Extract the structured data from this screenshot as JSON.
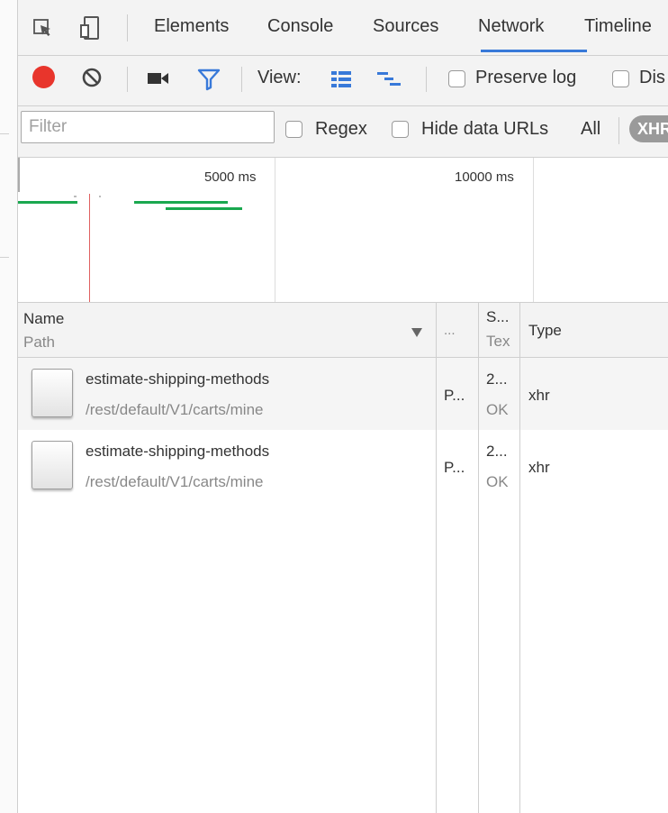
{
  "tabs": {
    "items": [
      {
        "label": "Elements"
      },
      {
        "label": "Console"
      },
      {
        "label": "Sources"
      },
      {
        "label": "Network"
      },
      {
        "label": "Timeline"
      }
    ],
    "active": "Network"
  },
  "toolbar": {
    "view_label": "View:",
    "preserve_log_label": "Preserve log",
    "disable_cache_label": "Dis"
  },
  "filterbar": {
    "filter_placeholder": "Filter",
    "regex_label": "Regex",
    "hide_data_urls_label": "Hide data URLs",
    "all_label": "All",
    "xhr_label": "XHR"
  },
  "overview": {
    "tick_labels": [
      "5000 ms",
      "10000 ms"
    ]
  },
  "table": {
    "headers": {
      "name": "Name",
      "path": "Path",
      "method_abbr": "...",
      "status": "S...",
      "status_text": "Tex",
      "type": "Type"
    },
    "rows": [
      {
        "name": "estimate-shipping-methods",
        "path": "/rest/default/V1/carts/mine",
        "method": "P...",
        "status": "2...",
        "status_text": "OK",
        "type": "xhr"
      },
      {
        "name": "estimate-shipping-methods",
        "path": "/rest/default/V1/carts/mine",
        "method": "P...",
        "status": "2...",
        "status_text": "OK",
        "type": "xhr"
      }
    ]
  },
  "colors": {
    "record_red": "#e8352c",
    "filter_blue": "#3879d9",
    "waterfall_green": "#1aa84f",
    "load_line_red": "#e06060"
  }
}
